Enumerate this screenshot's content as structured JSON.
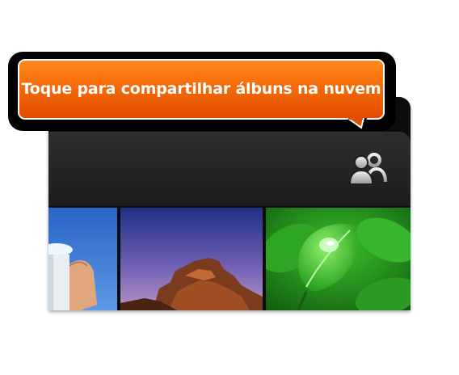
{
  "tooltip": {
    "text": "Toque para compartilhar álbuns na nuvem"
  },
  "action_bar": {
    "share_icon": "people-share-icon",
    "clipped_char": "0"
  },
  "gallery": {
    "thumbnails": [
      {
        "name": "thumbnail-milk-bottle",
        "description_icon": "photo"
      },
      {
        "name": "thumbnail-desert-rock",
        "description_icon": "photo"
      },
      {
        "name": "thumbnail-green-leaf",
        "description_icon": "photo"
      }
    ]
  },
  "colors": {
    "callout_top": "#ff8a1c",
    "callout_bottom": "#e24d00",
    "action_bar": "#262626"
  }
}
